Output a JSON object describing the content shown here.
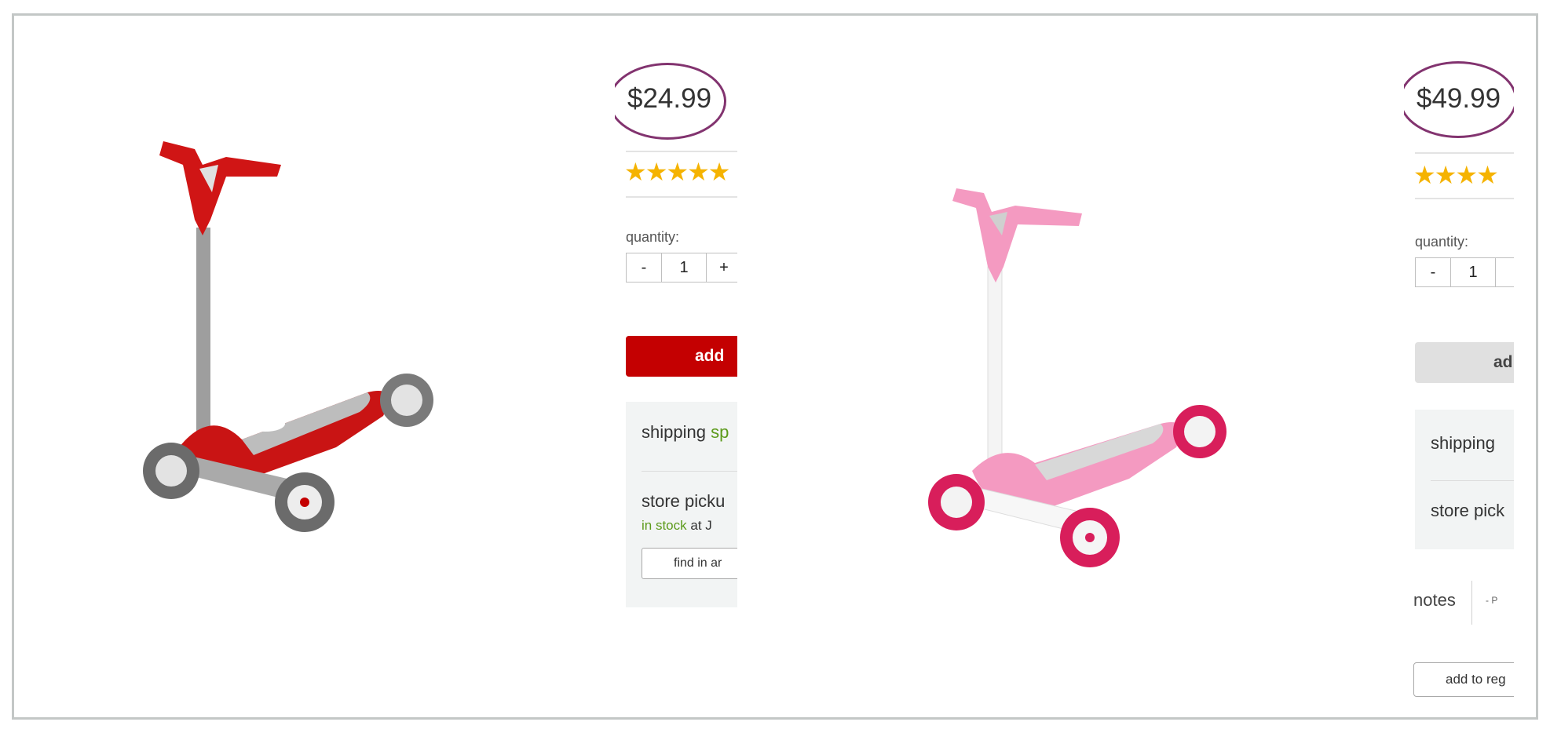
{
  "product_1": {
    "price": "$24.99",
    "rating_stars": "★★★★★",
    "quantity_label": "quantity:",
    "quantity_minus": "-",
    "quantity_value": "1",
    "quantity_plus": "+",
    "add_button": "add",
    "shipping_label": "shipping",
    "shipping_status": "sp",
    "store_pickup_label": "store picku",
    "stock_status": "in stock",
    "stock_location": "at J",
    "find_button": "find in ar",
    "colors": {
      "scooter_body": "#cc1a1a",
      "add_button": "#c40001"
    }
  },
  "product_2": {
    "price": "$49.99",
    "rating_stars": "★★★★",
    "quantity_label": "quantity:",
    "quantity_minus": "-",
    "quantity_value": "1",
    "add_button": "ad",
    "shipping_label": "shipping",
    "store_pickup_label": "store pick",
    "notes_label": "notes",
    "notes_text": "- P",
    "registry_button": "add to reg",
    "colors": {
      "scooter_body": "#f49ac1",
      "wheel": "#d81e5b"
    }
  },
  "highlight_color": "#82336f"
}
